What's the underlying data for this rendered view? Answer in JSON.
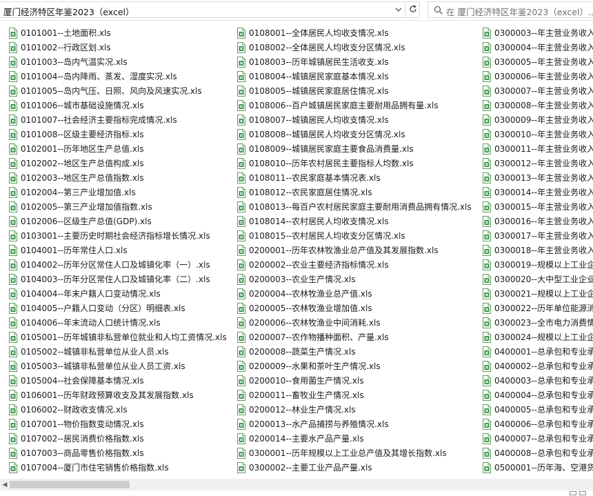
{
  "address_bar": {
    "path": "厦门经济特区年鉴2023（excel）"
  },
  "search": {
    "placeholder": "在 厦门经济特区年鉴2023（excel）..."
  },
  "file_icon": "excel-file-icon",
  "columns": [
    [
      "0101001--土地面积.xls",
      "0101002--行政区划.xls",
      "0101003--岛内气温实况.xls",
      "0101004--岛内降雨、蒸发、湿度实况.xls",
      "0101005--岛内气压、日照、风向及风速实况.xls",
      "0101006--城市基础设施情况.xls",
      "0101007--社会经济主要指标完成情况.xls",
      "0101008--区级主要经济指标.xls",
      "0102001--历年地区生产总值.xls",
      "0102002--地区生产总值构成.xls",
      "0102003--地区生产总值指数.xls",
      "0102004--第三产业增加值.xls",
      "0102005--第三产业增加值指数.xls",
      "0102006--区级生产总值(GDP).xls",
      "0103001--主要历史时期社会经济指标增长情况.xls",
      "0104001--历年常住人口.xls",
      "0104002--历年分区常住人口及城镇化率（一）.xls",
      "0104003--历年分区常住人口及城镇化率（二）.xls",
      "0104004--年末户籍人口变动情况.xls",
      "0104005--户籍人口变动（分区）明细表.xls",
      "0104006--年末流动人口统计情况.xls",
      "0105001--历年城镇非私营单位就业和人均工资情况.xls",
      "0105002--城镇非私营单位从业人员.xls",
      "0105003--城镇非私营单位从业人员工资.xls",
      "0105004--社会保障基本情况.xls",
      "0106001--历年财政预算收支及其发展指数.xls",
      "0106002--财政收支情况.xls",
      "0107001--物价指数变动情况.xls",
      "0107002--居民消费价格指数.xls",
      "0107003--商品零售价格指数.xls",
      "0107004--厦门市住宅销售价格指数.xls"
    ],
    [
      "0108001--全体居民人均收支情况.xls",
      "0108002--全体居民人均收支分区情况.xls",
      "0108003--历年城镇居民生活收支.xls",
      "0108004--城镇居民家庭基本情况.xls",
      "0108005--城镇居民家庭居住情况.xls",
      "0108006--百户城镇居民家庭主要耐用品拥有量.xls",
      "0108007--城镇居民人均收支情况.xls",
      "0108008--城镇居民人均收支分区情况.xls",
      "0108009--城镇居民家庭主要食品消费量.xls",
      "0108010--历年农村居民主要指标人均数.xls",
      "0108011--农民家庭基本情况表.xls",
      "0108012--农民家庭居住情况.xls",
      "0108013--每百户农村居民家庭主要耐用消费品拥有情况.xls",
      "0108014--农村居民人均收支情况.xls",
      "0108015--农村居民人均收支分区情况.xls",
      "0200001--历年农林牧渔业总产值及其发展指数.xls",
      "0200002--农业主要经济指标情况.xls",
      "0200003--农业生产情况.xls",
      "0200004--农林牧渔业总产值.xls",
      "0200005--农林牧渔业增加值.xls",
      "0200006--农林牧渔业中间消耗.xls",
      "0200007--农作物播种面积、产量.xls",
      "0200008--蔬菜生产情况.xls",
      "0200009--水果和茶叶生产情况.xls",
      "0200010--食用菌生产情况.xls",
      "0200011--畜牧业生产情况.xls",
      "0200012--林业生产情况.xls",
      "0200013--水产品捕捞与养殖情况.xls",
      "0200014--主要水产品产量.xls",
      "0300001--历年规模以上工业总产值及其增长指数.xls",
      "0300002--主要工业产品产量.xls"
    ],
    [
      "0300003--年主营业务收入",
      "0300004--年主营业务收入",
      "0300005--年主营业务收入",
      "0300006--年主营业务收入",
      "0300007--年主营业务收入",
      "0300008--年主营业务收入",
      "0300009--年主营业务收入",
      "0300010--年主营业务收入",
      "0300011--年主营业务收入",
      "0300012--年主营业务收入",
      "0300013--年主营业务收入",
      "0300014--年主营业务收入",
      "0300015--年主营业务收入",
      "0300016--年主营业务收入",
      "0300017--年主营业务收入",
      "0300018--年主营业务收入",
      "0300019--规模以上工业企",
      "0300020--大中型工业企业",
      "0300021--规模以上工业企",
      "0300022--历年单位能源消",
      "0300023--全市电力消费情",
      "0300024--规模以上工业企",
      "0400001--总承包和专业承",
      "0400002--总承包和专业承",
      "0400003--总承包和专业承",
      "0400004--总承包和专业承",
      "0400005--总承包和专业承",
      "0400006--总承包和专业承",
      "0400007--总承包和专业承",
      "0400008--总承包和专业承",
      "0500001--历年海、空港货"
    ]
  ]
}
